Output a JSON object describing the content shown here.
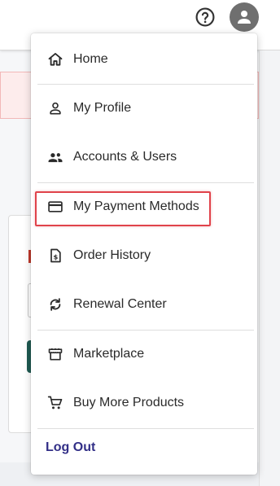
{
  "header": {
    "help_icon": "help-circle-icon",
    "avatar_icon": "account-icon"
  },
  "menu": {
    "items": [
      {
        "label": "Home",
        "icon": "home-icon"
      },
      {
        "label": "My Profile",
        "icon": "person-icon"
      },
      {
        "label": "Accounts & Users",
        "icon": "people-icon"
      },
      {
        "label": "My Payment Methods",
        "icon": "credit-card-icon",
        "highlighted": true
      },
      {
        "label": "Order History",
        "icon": "receipt-dollar-icon"
      },
      {
        "label": "Renewal Center",
        "icon": "renew-icon"
      },
      {
        "label": "Marketplace",
        "icon": "storefront-icon"
      },
      {
        "label": "Buy More Products",
        "icon": "shopping-cart-icon"
      }
    ],
    "logout_label": "Log Out"
  },
  "colors": {
    "logout_text": "#322f87",
    "highlight_border": "#e0434b",
    "avatar_bg": "#6f6f6f"
  }
}
